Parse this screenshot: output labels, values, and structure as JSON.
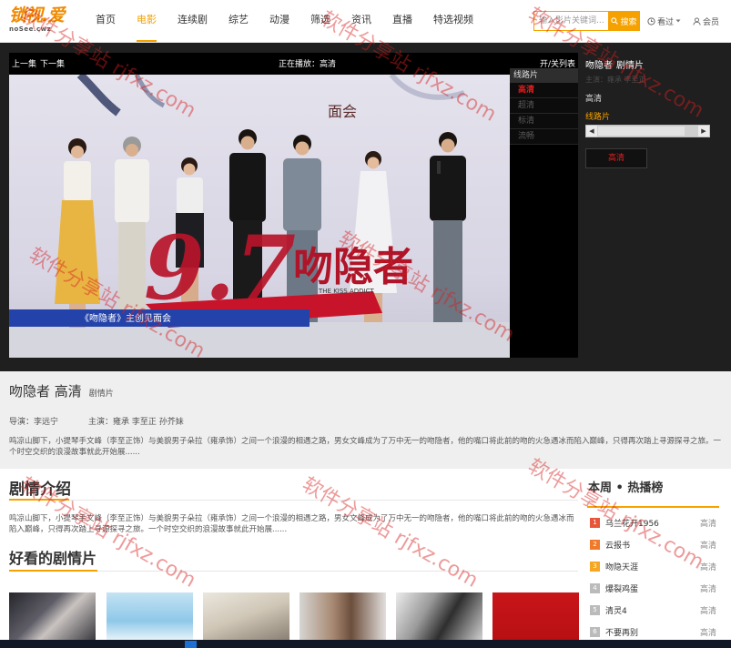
{
  "logo": {
    "name": "锁视.爱",
    "tagline": "noSee.cwz"
  },
  "nav": {
    "items": [
      "首页",
      "电影",
      "连续剧",
      "综艺",
      "动漫",
      "筛选",
      "资讯",
      "直播",
      "特选视频"
    ],
    "active_index": 1
  },
  "search": {
    "placeholder": "输入影片关键词...",
    "button": "搜索"
  },
  "user": {
    "history": "看过",
    "member": "会员"
  },
  "player": {
    "prev": "上一集",
    "next": "下一集",
    "now_playing": "正在播放：高清",
    "toggle_list": "开/关列表",
    "list_title": "线路片",
    "list_items": [
      "高清",
      "超清",
      "标清",
      "流畅"
    ]
  },
  "video_frame": {
    "sign": "面会",
    "score": "9.7",
    "film": "吻隐者",
    "film_en": "THE KISS ADDICT",
    "banner": "《吻隐者》主创见面会"
  },
  "side": {
    "title": "吻隐者",
    "genre": "剧情片",
    "meta": "主演：雍承 李至正",
    "quality": "高清",
    "source": "线路片",
    "button": "高清"
  },
  "info": {
    "title": "吻隐者 高清",
    "genre": "剧情片",
    "director_label": "导演：",
    "director": "李远宁",
    "cast_label": "主演：",
    "cast": "雍承 李至正 孙芥妹",
    "desc": "鸣凉山脚下，小提琴手文峰（李至正饰）与美貌男子朵拉（雍承饰）之间一个浪漫的相遇之路，男女文峰成为了万中无一的吻隐者，他的嘴口将此前的吻的火急遇冰而陷入巅峰，只得再次踏上寻源探寻之旅。一个时空交织的浪漫故事就此开始展......"
  },
  "intro": {
    "heading": "剧情介绍",
    "text": "鸣凉山脚下，小提琴手文峰（李至正饰）与美貌男子朵拉（雍承饰）之间一个浪漫的相遇之路，男女文峰成为了万中无一的吻隐者，他的嘴口将此前的吻的火急遇冰而陷入巅峰，只得再次踏上寻源探寻之旅。一个时空交织的浪漫故事就此开始展......"
  },
  "related": {
    "heading": "好看的剧情片"
  },
  "ranking": {
    "heading": "本周 • 热播榜",
    "items": [
      {
        "rank": "1",
        "name": "乌兰花开1956",
        "tag": "高清"
      },
      {
        "rank": "2",
        "name": "云报书",
        "tag": "高清"
      },
      {
        "rank": "3",
        "name": "吻隐天涯",
        "tag": "高清"
      },
      {
        "rank": "4",
        "name": "爆裂鸡蛋",
        "tag": "高清"
      },
      {
        "rank": "5",
        "name": "清灵4",
        "tag": "高清"
      },
      {
        "rank": "6",
        "name": "不要再别",
        "tag": "高清"
      }
    ]
  },
  "watermark": "软件分享站 rjfxz.com",
  "colors": {
    "accent": "#f5a100",
    "active_source": "#e02020",
    "rank_top": [
      "#e8563a",
      "#f07a2a",
      "#f5a623"
    ],
    "rank_other": "#bbbbbb"
  }
}
